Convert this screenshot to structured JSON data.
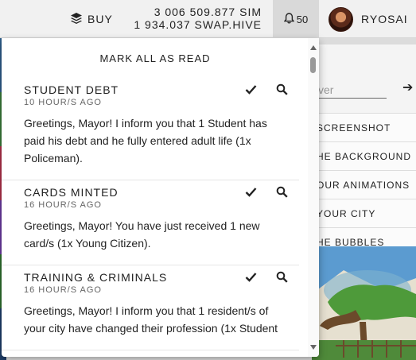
{
  "topbar": {
    "buy_label": "BUY",
    "balance_sim": "3 006 509.877 SIM",
    "balance_swap_hive": "1 934.037 SWAP.HIVE",
    "notifications_count": "50",
    "username": "RYOSAI"
  },
  "side_panel": {
    "search_placeholder": "ver",
    "settings_items": [
      "SCREENSHOT",
      "HE BACKGROUND",
      "OUR ANIMATIONS",
      "YOUR CITY",
      "HE BUBBLES"
    ]
  },
  "notifications": {
    "mark_all_label": "MARK ALL AS READ",
    "items": [
      {
        "title": "STUDENT DEBT",
        "time": "10 HOUR/S AGO",
        "message": "Greetings, Mayor! I inform you that 1 Student has paid his debt and he fully entered adult life (1x Policeman)."
      },
      {
        "title": "CARDS MINTED",
        "time": "16 HOUR/S AGO",
        "message": "Greetings, Mayor! You have just received 1 new card/s (1x Young Citizen)."
      },
      {
        "title": "TRAINING & CRIMINALS",
        "time": "16 HOUR/S AGO",
        "message": "Greetings, Mayor! I inform you that 1 resident/s of your city have changed their profession (1x Student"
      }
    ]
  },
  "colors": {
    "topbar_bg": "#f1f1f1",
    "bell_active_bg": "#d9d9d9",
    "dropdown_bg": "#ffffff",
    "scene_sky": "#5b9bd0"
  }
}
